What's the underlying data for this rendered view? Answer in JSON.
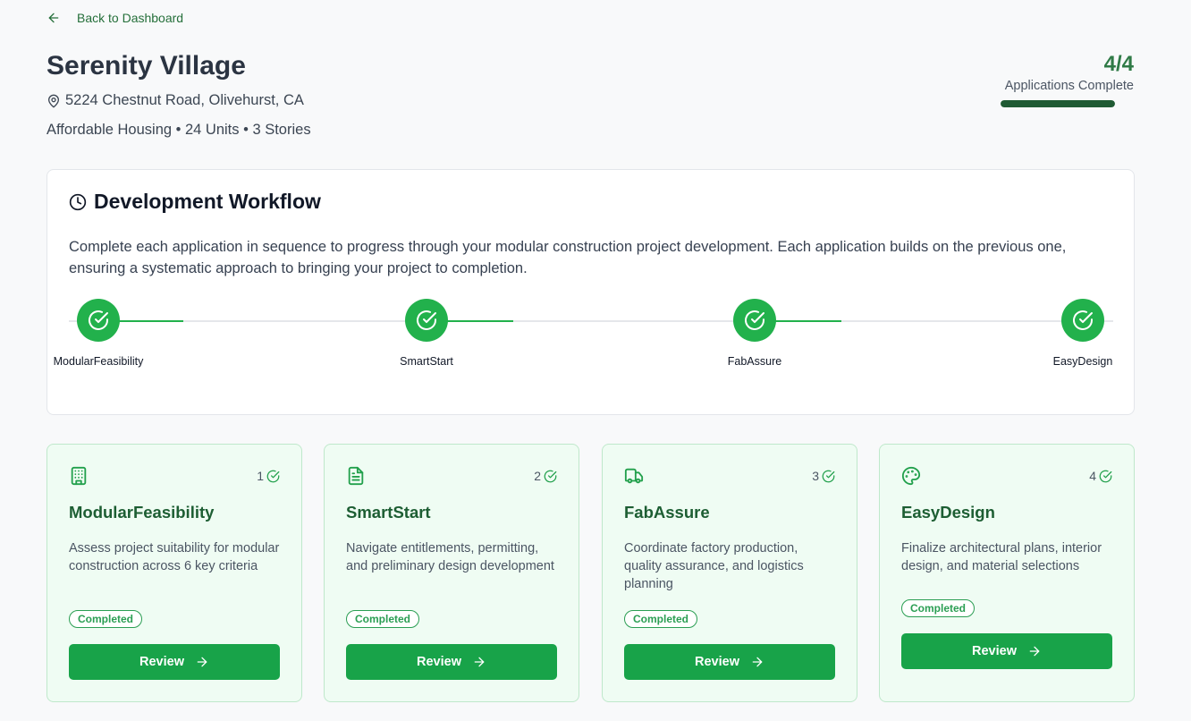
{
  "nav": {
    "back_label": "Back to Dashboard"
  },
  "project": {
    "name": "Serenity Village",
    "address": "5224 Chestnut Road, Olivehurst, CA",
    "meta": "Affordable Housing • 24 Units • 3 Stories"
  },
  "progress": {
    "count": "4/4",
    "label": "Applications Complete",
    "fraction": 1.0,
    "color": "#1f5a33"
  },
  "workflow": {
    "title": "Development Workflow",
    "description": "Complete each application in sequence to progress through your modular construction project development. Each application builds on the previous one, ensuring a systematic approach to bringing your project to completion.",
    "steps": [
      {
        "label": "ModularFeasibility",
        "status": "completed"
      },
      {
        "label": "SmartStart",
        "status": "completed"
      },
      {
        "label": "FabAssure",
        "status": "completed"
      },
      {
        "label": "EasyDesign",
        "status": "completed"
      }
    ]
  },
  "cards": [
    {
      "number": "1",
      "icon": "building-icon",
      "title": "ModularFeasibility",
      "description": "Assess project suitability for modular construction across 6 key criteria",
      "badge": "Completed",
      "button": "Review"
    },
    {
      "number": "2",
      "icon": "document-icon",
      "title": "SmartStart",
      "description": "Navigate entitlements, permitting, and preliminary design development",
      "badge": "Completed",
      "button": "Review"
    },
    {
      "number": "3",
      "icon": "truck-icon",
      "title": "FabAssure",
      "description": "Coordinate factory production, quality assurance, and logistics planning",
      "badge": "Completed",
      "button": "Review"
    },
    {
      "number": "4",
      "icon": "palette-icon",
      "title": "EasyDesign",
      "description": "Finalize architectural plans, interior design, and material selections",
      "badge": "Completed",
      "button": "Review"
    }
  ],
  "colors": {
    "accent": "#22b14c",
    "button": "#18a349",
    "title_green": "#1d5e33"
  }
}
